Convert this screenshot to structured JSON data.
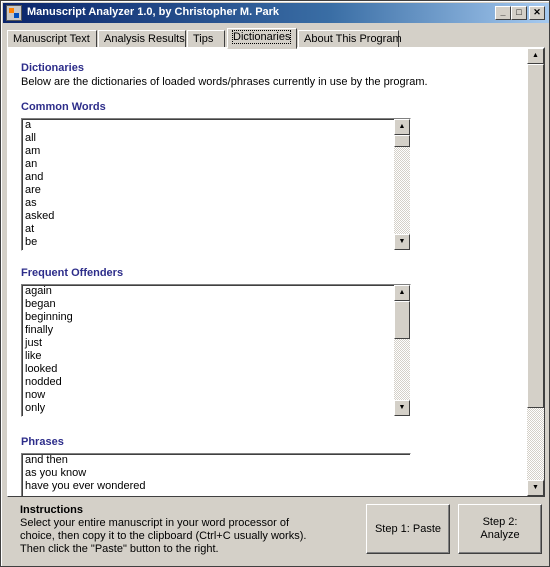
{
  "window": {
    "title": "Manuscript Analyzer 1.0, by Christopher M. Park",
    "min_glyph": "_",
    "max_glyph": "□",
    "close_glyph": "✕"
  },
  "tabs": [
    {
      "label": "Manuscript Text",
      "active": false
    },
    {
      "label": "Analysis Results",
      "active": false
    },
    {
      "label": "Tips",
      "active": false
    },
    {
      "label": "Dictionaries",
      "active": true
    },
    {
      "label": "About This Program",
      "active": false
    }
  ],
  "dictionaries": {
    "title": "Dictionaries",
    "description": "Below are the dictionaries of loaded words/phrases currently in use by the program.",
    "common_words": {
      "heading": "Common Words",
      "items": [
        "a",
        "all",
        "am",
        "an",
        "and",
        "are",
        "as",
        "asked",
        "at",
        "be"
      ]
    },
    "frequent_offenders": {
      "heading": "Frequent Offenders",
      "items": [
        "again",
        "began",
        "beginning",
        "finally",
        "just",
        "like",
        "looked",
        "nodded",
        "now",
        "only"
      ]
    },
    "phrases": {
      "heading": "Phrases",
      "items": [
        "and then",
        "as you know",
        "have you ever wondered"
      ]
    }
  },
  "instructions": {
    "title": "Instructions",
    "line1": "Select your entire manuscript in your word processor of",
    "line2": "choice, then copy it to the clipboard (Ctrl+C usually works).",
    "line3": "Then click the \"Paste\" button to the right."
  },
  "buttons": {
    "paste": "Step 1: Paste",
    "analyze_line1": "Step 2:",
    "analyze_line2": "Analyze"
  },
  "icons": {
    "scroll_up": "▲",
    "scroll_down": "▼"
  }
}
